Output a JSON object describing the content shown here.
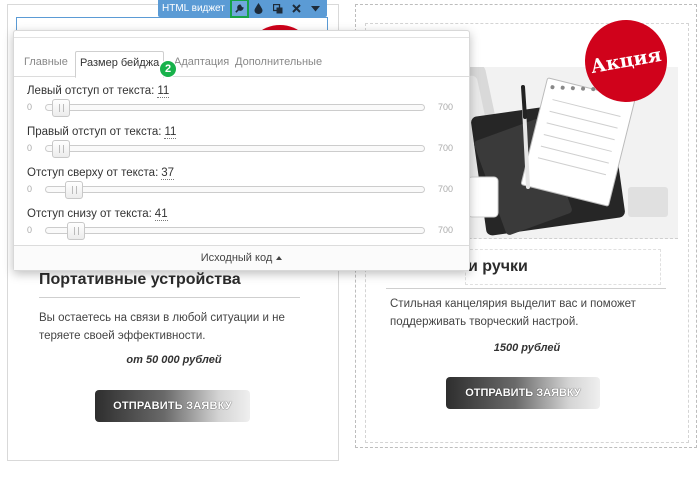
{
  "toolbar": {
    "title": "HTML виджет",
    "icons": [
      "wrench-icon",
      "drop-icon",
      "copy-icon",
      "close-icon",
      "caret-down-icon"
    ]
  },
  "popup": {
    "tabs": [
      {
        "label": "Главные",
        "active": false
      },
      {
        "label": "Размер бейджа",
        "active": true
      },
      {
        "label": "Адаптация",
        "active": false
      },
      {
        "label": "Дополнительные",
        "active": false
      }
    ],
    "marker": "2",
    "settings": [
      {
        "label": "Левый отступ от текста:",
        "value": "11",
        "min": "0",
        "max": "700",
        "fraction": 0.0157
      },
      {
        "label": "Правый отступ от текста:",
        "value": "11",
        "min": "0",
        "max": "700",
        "fraction": 0.0157
      },
      {
        "label": "Отступ сверху от текста:",
        "value": "37",
        "min": "0",
        "max": "700",
        "fraction": 0.0529
      },
      {
        "label": "Отступ снизу от текста:",
        "value": "41",
        "min": "0",
        "max": "700",
        "fraction": 0.0586
      }
    ],
    "footer": "Исходный код"
  },
  "card_left": {
    "title": "Портативные устройства",
    "description": "Вы остаетесь на связи в любой ситуации и не теряете своей эффективности.",
    "price": "от 50 000 рублей",
    "button": "ОТПРАВИТЬ ЗАЯВКУ"
  },
  "card_right": {
    "badge": "Акция",
    "title": "и ручки",
    "description": "Стильная канцелярия выделит вас и поможет поддерживать творческий настрой.",
    "price": "1500 рублей",
    "button": "ОТПРАВИТЬ ЗАЯВКУ"
  },
  "colors": {
    "toolbar": "#5b9bd5",
    "active_highlight": "#17a34a",
    "badge": "#d0021b"
  }
}
